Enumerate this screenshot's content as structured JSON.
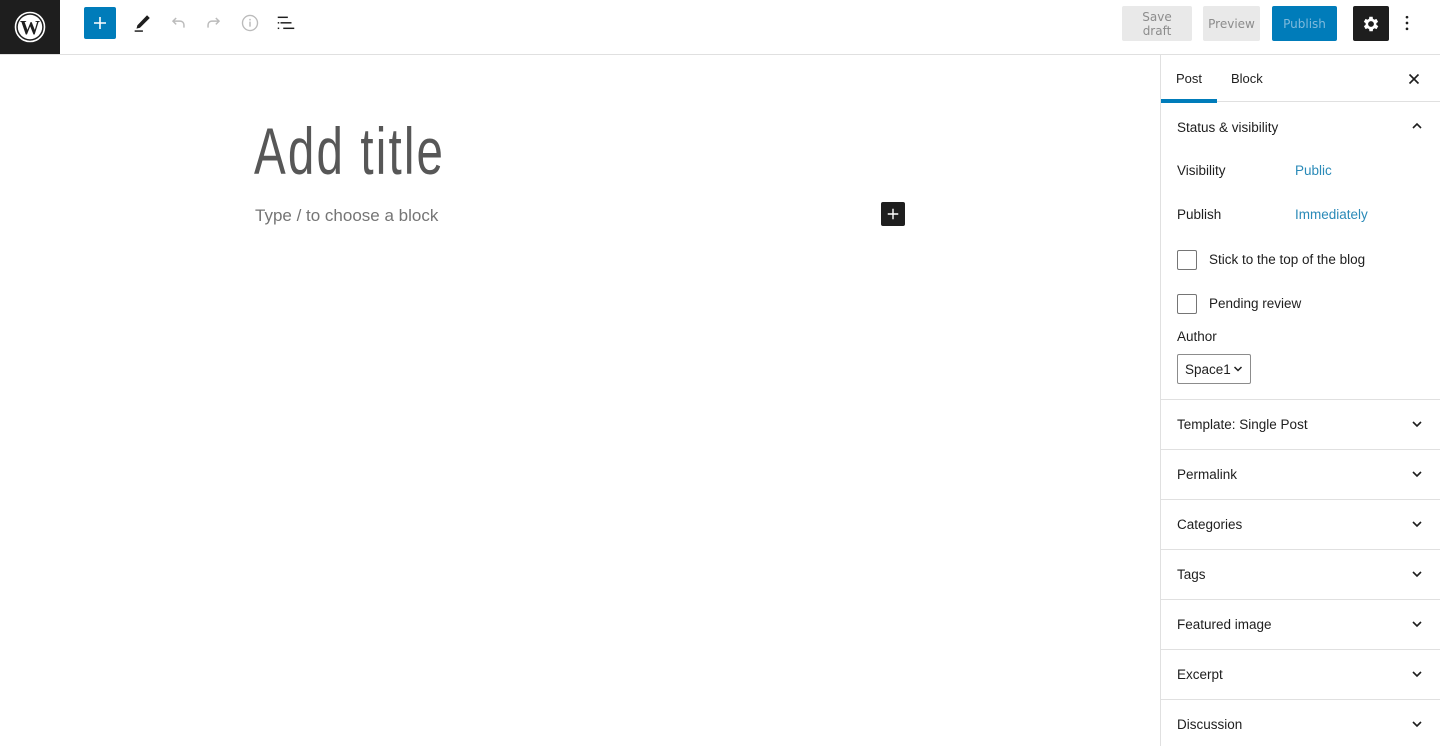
{
  "header": {
    "logo": "wordpress-logo",
    "toolbar": {
      "inserter_icon": "plus-icon",
      "tools_icon": "pencil-icon",
      "undo_icon": "undo-icon",
      "redo_icon": "redo-icon",
      "details_icon": "info-icon",
      "list_view_icon": "list-view-icon"
    },
    "save_draft_label": "Save draft",
    "preview_label": "Preview",
    "publish_label": "Publish",
    "settings_icon": "gear-icon",
    "more_icon": "more-vertical-icon"
  },
  "editor": {
    "title_placeholder": "Add title",
    "block_placeholder": "Type / to choose a block",
    "inline_inserter_icon": "plus-icon"
  },
  "sidebar": {
    "tabs": [
      {
        "label": "Post",
        "active": true
      },
      {
        "label": "Block",
        "active": false
      }
    ],
    "close_icon": "close-icon",
    "status_panel": {
      "title": "Status & visibility",
      "expanded": true,
      "visibility_label": "Visibility",
      "visibility_value": "Public",
      "publish_label": "Publish",
      "publish_value": "Immediately",
      "sticky_label": "Stick to the top of the blog",
      "sticky_checked": false,
      "pending_label": "Pending review",
      "pending_checked": false,
      "author_label": "Author",
      "author_value": "Space1"
    },
    "panels": [
      {
        "title": "Template: Single Post"
      },
      {
        "title": "Permalink"
      },
      {
        "title": "Categories"
      },
      {
        "title": "Tags"
      },
      {
        "title": "Featured image"
      },
      {
        "title": "Excerpt"
      },
      {
        "title": "Discussion"
      }
    ]
  },
  "colors": {
    "accent": "#007cba",
    "dark": "#1e1e1e",
    "link": "#2a8ab8"
  }
}
